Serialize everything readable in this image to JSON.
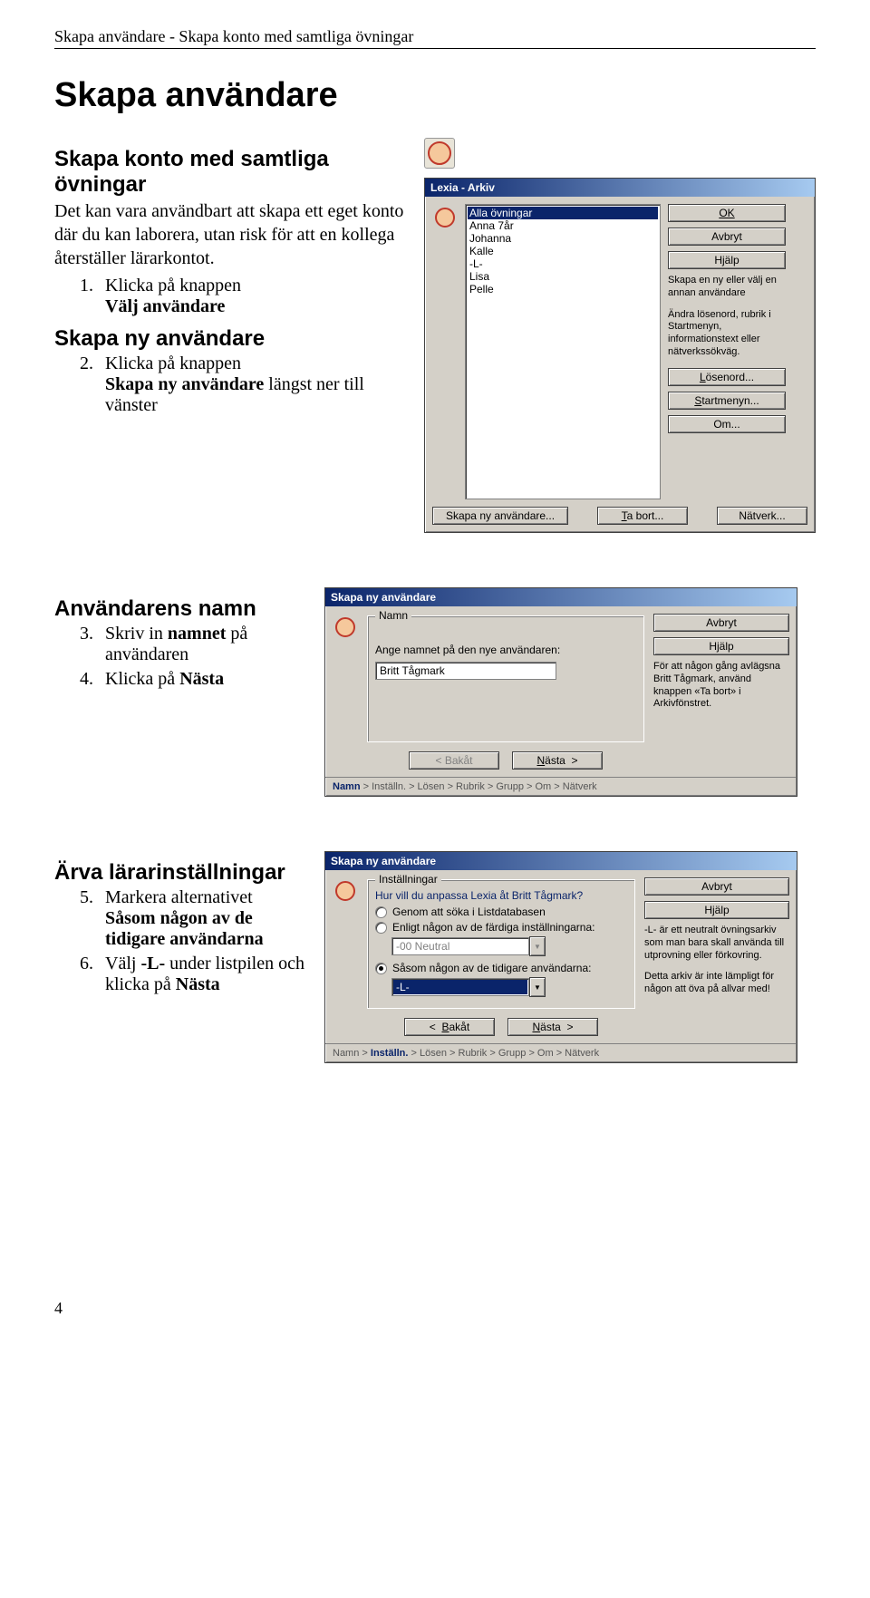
{
  "header": "Skapa användare - Skapa konto med samtliga övningar",
  "h1": "Skapa användare",
  "section1": {
    "title": "Skapa konto med samtliga övningar",
    "intro": "Det kan vara användbart att skapa ett eget konto där du kan laborera, utan risk för att en kollega återställer lärarkontot.",
    "step1_num": "1.",
    "step1_pre": "Klicka på knappen",
    "step1_bold": "Välj användare"
  },
  "section2": {
    "title": "Skapa ny användare",
    "step2_num": "2.",
    "step2_pre": "Klicka på knappen",
    "step2_bold": "Skapa ny användare",
    "step2_post": "längst ner till vänster"
  },
  "dialog1": {
    "title": "Lexia - Arkiv",
    "list": [
      "Alla övningar",
      "Anna 7år",
      "Johanna",
      "Kalle",
      "-L-",
      "Lisa",
      "Pelle"
    ],
    "btn_ok": "OK",
    "btn_cancel": "Avbryt",
    "btn_help": "Hjälp",
    "note1": "Skapa en ny eller välj en annan användare",
    "note2": "Ändra lösenord, rubrik i Startmenyn, informationstext eller nätverkssökväg.",
    "btn_pass": "Lösenord...",
    "btn_start": "Startmenyn...",
    "btn_om": "Om...",
    "btn_create": "Skapa ny användare...",
    "btn_remove": "Ta bort...",
    "btn_net": "Nätverk..."
  },
  "section3": {
    "title": "Användarens namn",
    "step3_num": "3.",
    "step3_pre": "Skriv in ",
    "step3_bold": "namnet",
    "step3_post": " på användaren",
    "step4_num": "4.",
    "step4_pre": " Klicka på ",
    "step4_bold": "Nästa"
  },
  "dialog2": {
    "title": "Skapa ny användare",
    "group_label": "Namn",
    "prompt": "Ange namnet på den nye användaren:",
    "input_value": "Britt Tågmark",
    "btn_cancel": "Avbryt",
    "btn_help": "Hjälp",
    "side_note": "För att någon gång avlägsna Britt Tågmark, använd knappen «Ta bort» i Arkivfönstret.",
    "btn_back": "<  Bakåt",
    "btn_next": "Nästa  >",
    "status": "Namn > Inställn. > Lösen > Rubrik > Grupp > Om > Nätverk",
    "status_active": "Namn"
  },
  "section4": {
    "title": "Ärva lärarinställningar",
    "step5_num": "5.",
    "step5_pre": "Markera alternativet",
    "step5_bold": "Såsom någon av de tidigare användarna",
    "step6_num": "6.",
    "step6_pre1": "Välj ",
    "step6_bold1": "-L-",
    "step6_mid": " under listpilen och klicka på ",
    "step6_bold2": "Nästa"
  },
  "dialog3": {
    "title": "Skapa ny användare",
    "group_label": "Inställningar",
    "question": "Hur vill du anpassa Lexia åt Britt Tågmark?",
    "opt1": "Genom att söka i Listdatabasen",
    "opt2": "Enligt någon av de färdiga inställningarna:",
    "opt2_combo": "-00 Neutral",
    "opt3": "Såsom någon av de tidigare användarna:",
    "opt3_combo": "-L-",
    "btn_cancel": "Avbryt",
    "btn_help": "Hjälp",
    "side_note1": "-L- är ett neutralt övningsarkiv som man bara skall använda till utprovning eller förkovring.",
    "side_note2": "Detta arkiv är inte lämpligt för någon att öva på allvar med!",
    "btn_back": "<  Bakåt",
    "btn_next": "Nästa  >",
    "status": "Namn > Inställn. > Lösen > Rubrik > Grupp > Om > Nätverk",
    "status_active": "Inställn."
  },
  "pagenum": "4"
}
